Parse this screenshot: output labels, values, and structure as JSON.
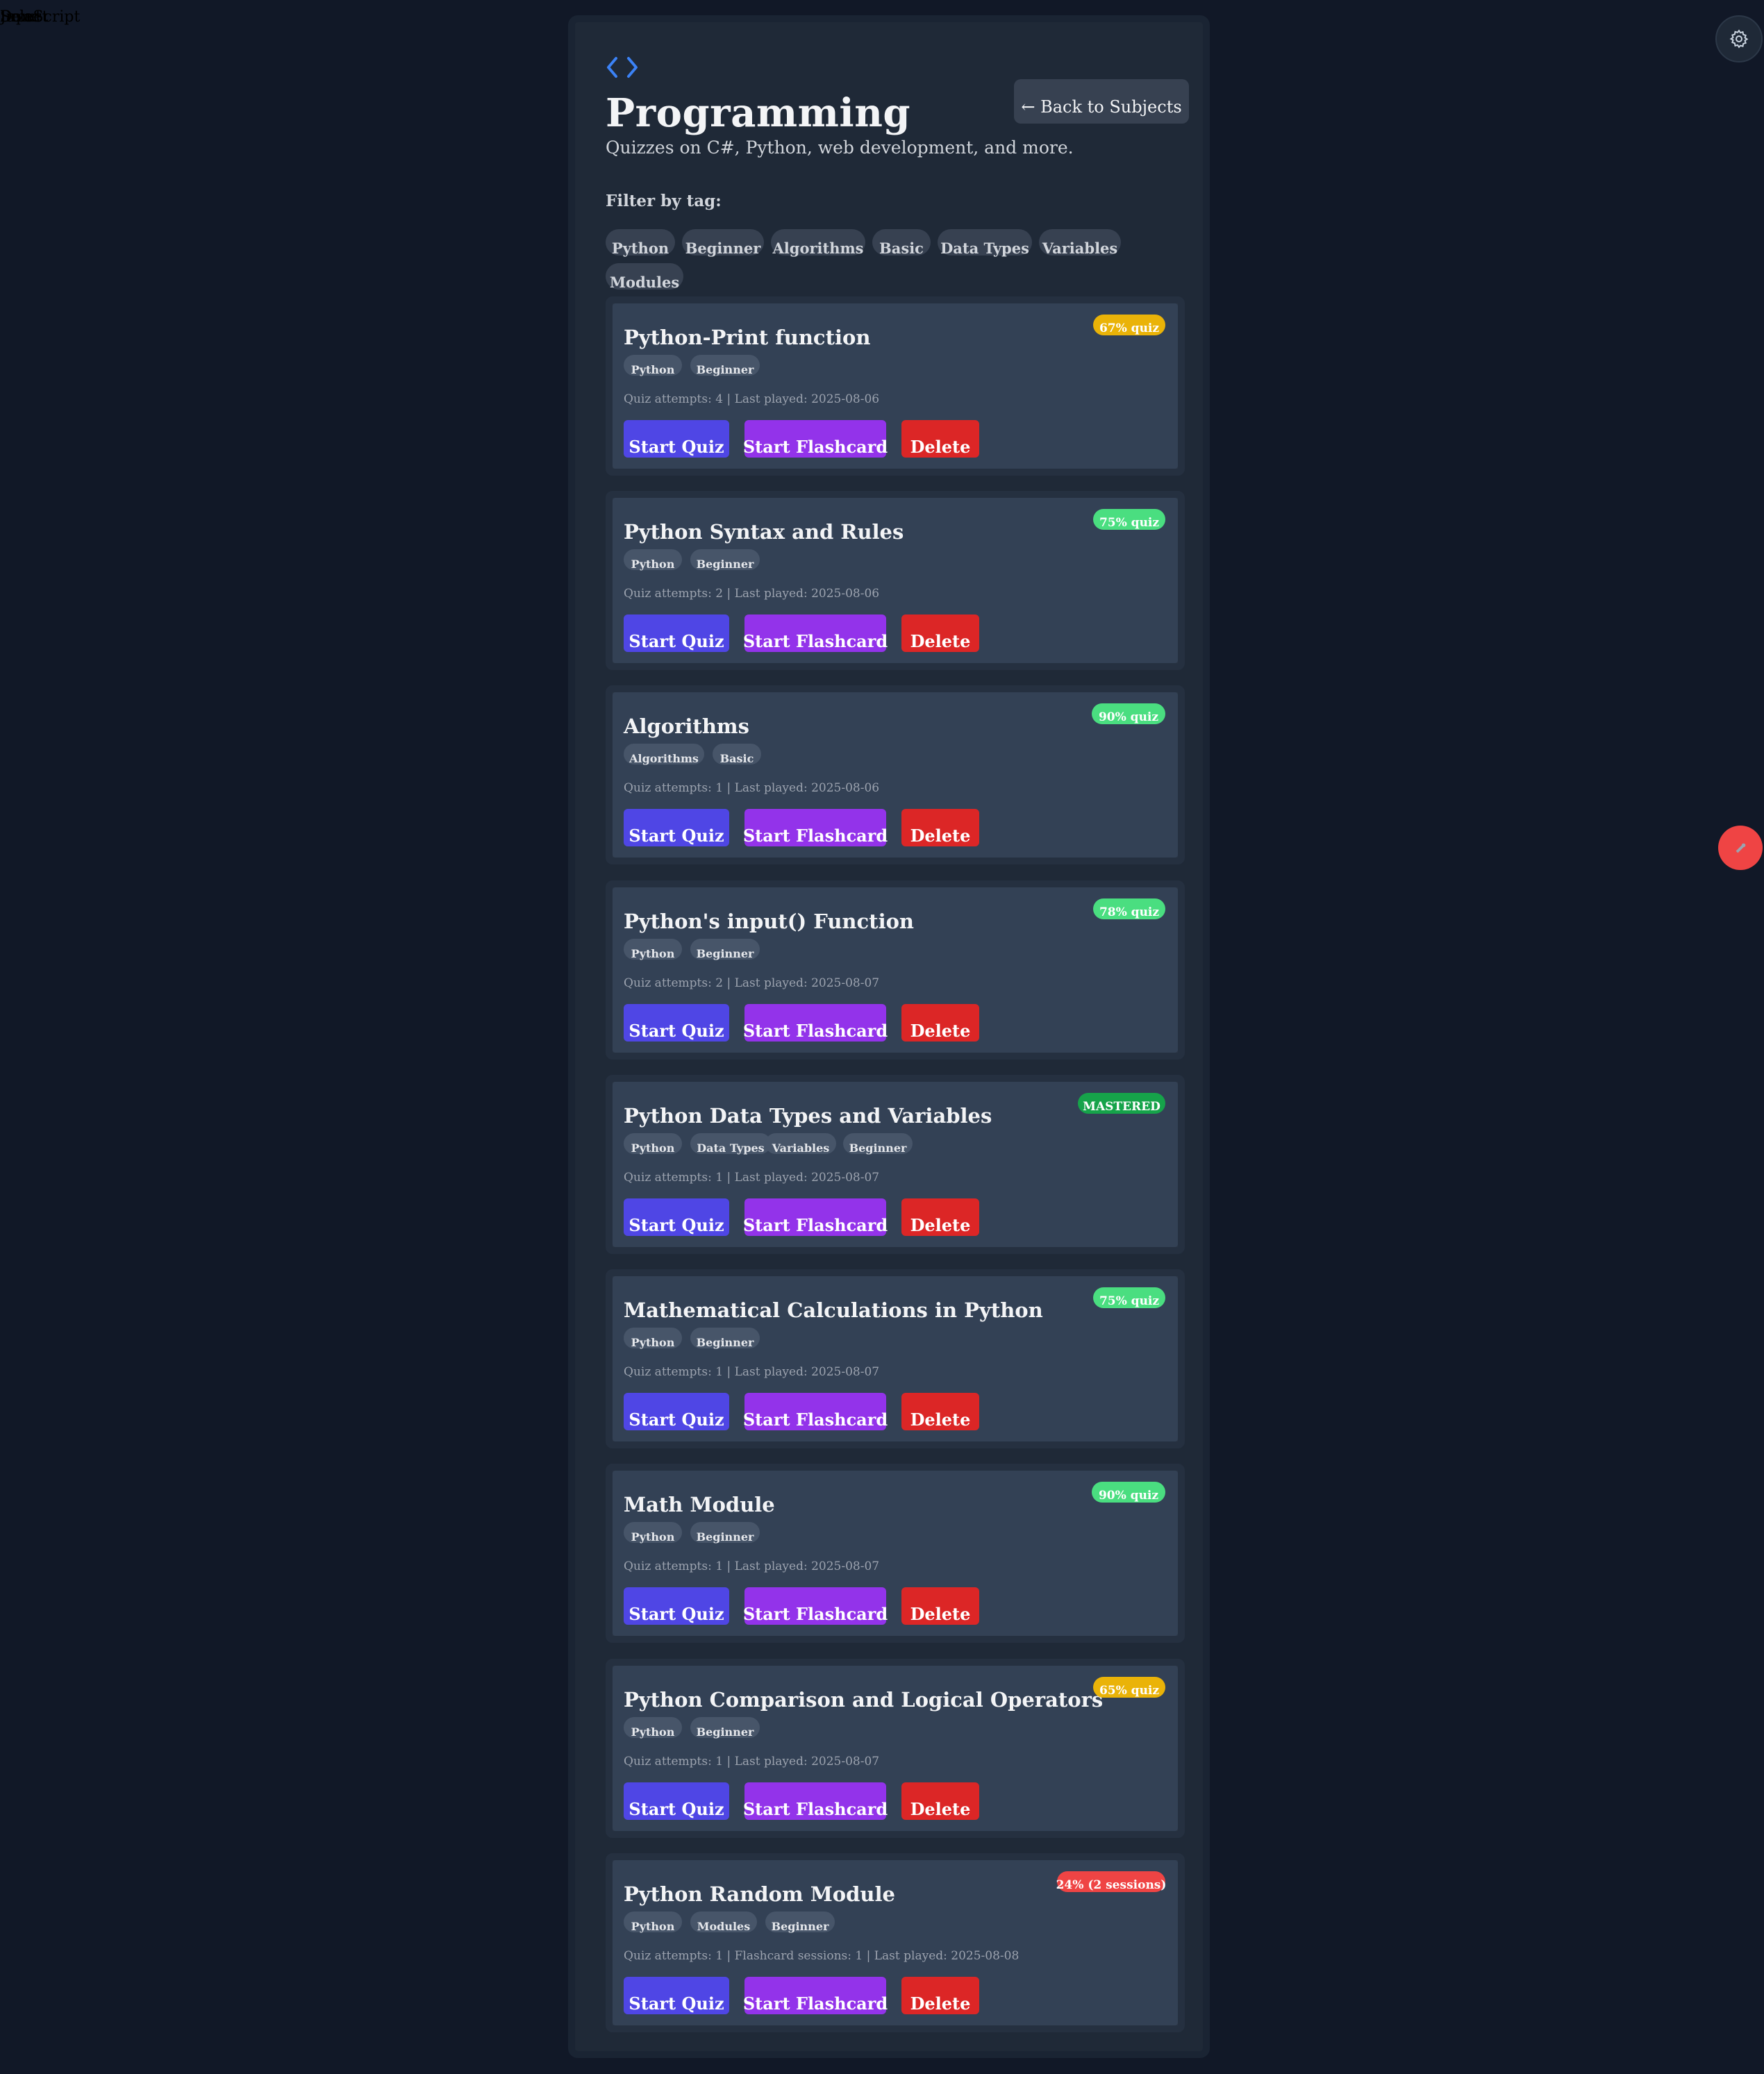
{
  "overlay": {
    "texts": [
      "JavaScript",
      "Input",
      "Done",
      "Select"
    ]
  },
  "header": {
    "title": "Programming",
    "subtitle": "Quizzes on C#, Python, web development, and more.",
    "back_label": "← Back to Subjects"
  },
  "filter": {
    "label": "Filter by tag:",
    "tags": [
      "Python",
      "Beginner",
      "Algorithms",
      "Basic",
      "Data Types",
      "Variables",
      "Modules"
    ]
  },
  "buttons": {
    "quiz": "Start Quiz",
    "flashcard": "Start Flashcard",
    "delete": "Delete"
  },
  "colors": {
    "badge_yellow": "#eab308",
    "badge_green": "#4ade80",
    "badge_mastered": "#16a34a",
    "badge_red": "#ef4444",
    "quiz_button": "#4f46e5",
    "flashcard_button": "#9333ea",
    "delete_button": "#dc2626"
  },
  "icons": {
    "header": "code-icon",
    "settings": "gear-icon",
    "fab": "bug-icon"
  },
  "quizzes": [
    {
      "title": "Python-Print function",
      "tags": [
        "Python",
        "Beginner"
      ],
      "meta": "Quiz attempts: 4 | Last played: 2025-08-06",
      "badge": "67% quiz",
      "badge_color": "#eab308"
    },
    {
      "title": "Python Syntax and Rules",
      "tags": [
        "Python",
        "Beginner"
      ],
      "meta": "Quiz attempts: 2 | Last played: 2025-08-06",
      "badge": "75% quiz",
      "badge_color": "#4ade80"
    },
    {
      "title": "Algorithms",
      "tags": [
        "Algorithms",
        "Basic"
      ],
      "meta": "Quiz attempts: 1 | Last played: 2025-08-06",
      "badge": "90% quiz",
      "badge_color": "#4ade80"
    },
    {
      "title": "Python's input() Function",
      "tags": [
        "Python",
        "Beginner"
      ],
      "meta": "Quiz attempts: 2 | Last played: 2025-08-07",
      "badge": "78% quiz",
      "badge_color": "#4ade80"
    },
    {
      "title": "Python Data Types and Variables",
      "tags": [
        "Python",
        "Data Types",
        "Variables",
        "Beginner"
      ],
      "meta": "Quiz attempts: 1 | Last played: 2025-08-07",
      "badge": "MASTERED",
      "badge_color": "#16a34a"
    },
    {
      "title": "Mathematical Calculations in Python",
      "tags": [
        "Python",
        "Beginner"
      ],
      "meta": "Quiz attempts: 1 | Last played: 2025-08-07",
      "badge": "75% quiz",
      "badge_color": "#4ade80"
    },
    {
      "title": "Math Module",
      "tags": [
        "Python",
        "Beginner"
      ],
      "meta": "Quiz attempts: 1 | Last played: 2025-08-07",
      "badge": "90% quiz",
      "badge_color": "#4ade80"
    },
    {
      "title": "Python Comparison and Logical Operators",
      "tags": [
        "Python",
        "Beginner"
      ],
      "meta": "Quiz attempts: 1 | Last played: 2025-08-07",
      "badge": "65% quiz",
      "badge_color": "#eab308"
    },
    {
      "title": "Python Random Module",
      "tags": [
        "Python",
        "Modules",
        "Beginner"
      ],
      "meta": "Quiz attempts: 1 | Flashcard sessions: 1 | Last played: 2025-08-08",
      "badge": "24% (2 sessions)",
      "badge_color": "#ef4444"
    }
  ]
}
